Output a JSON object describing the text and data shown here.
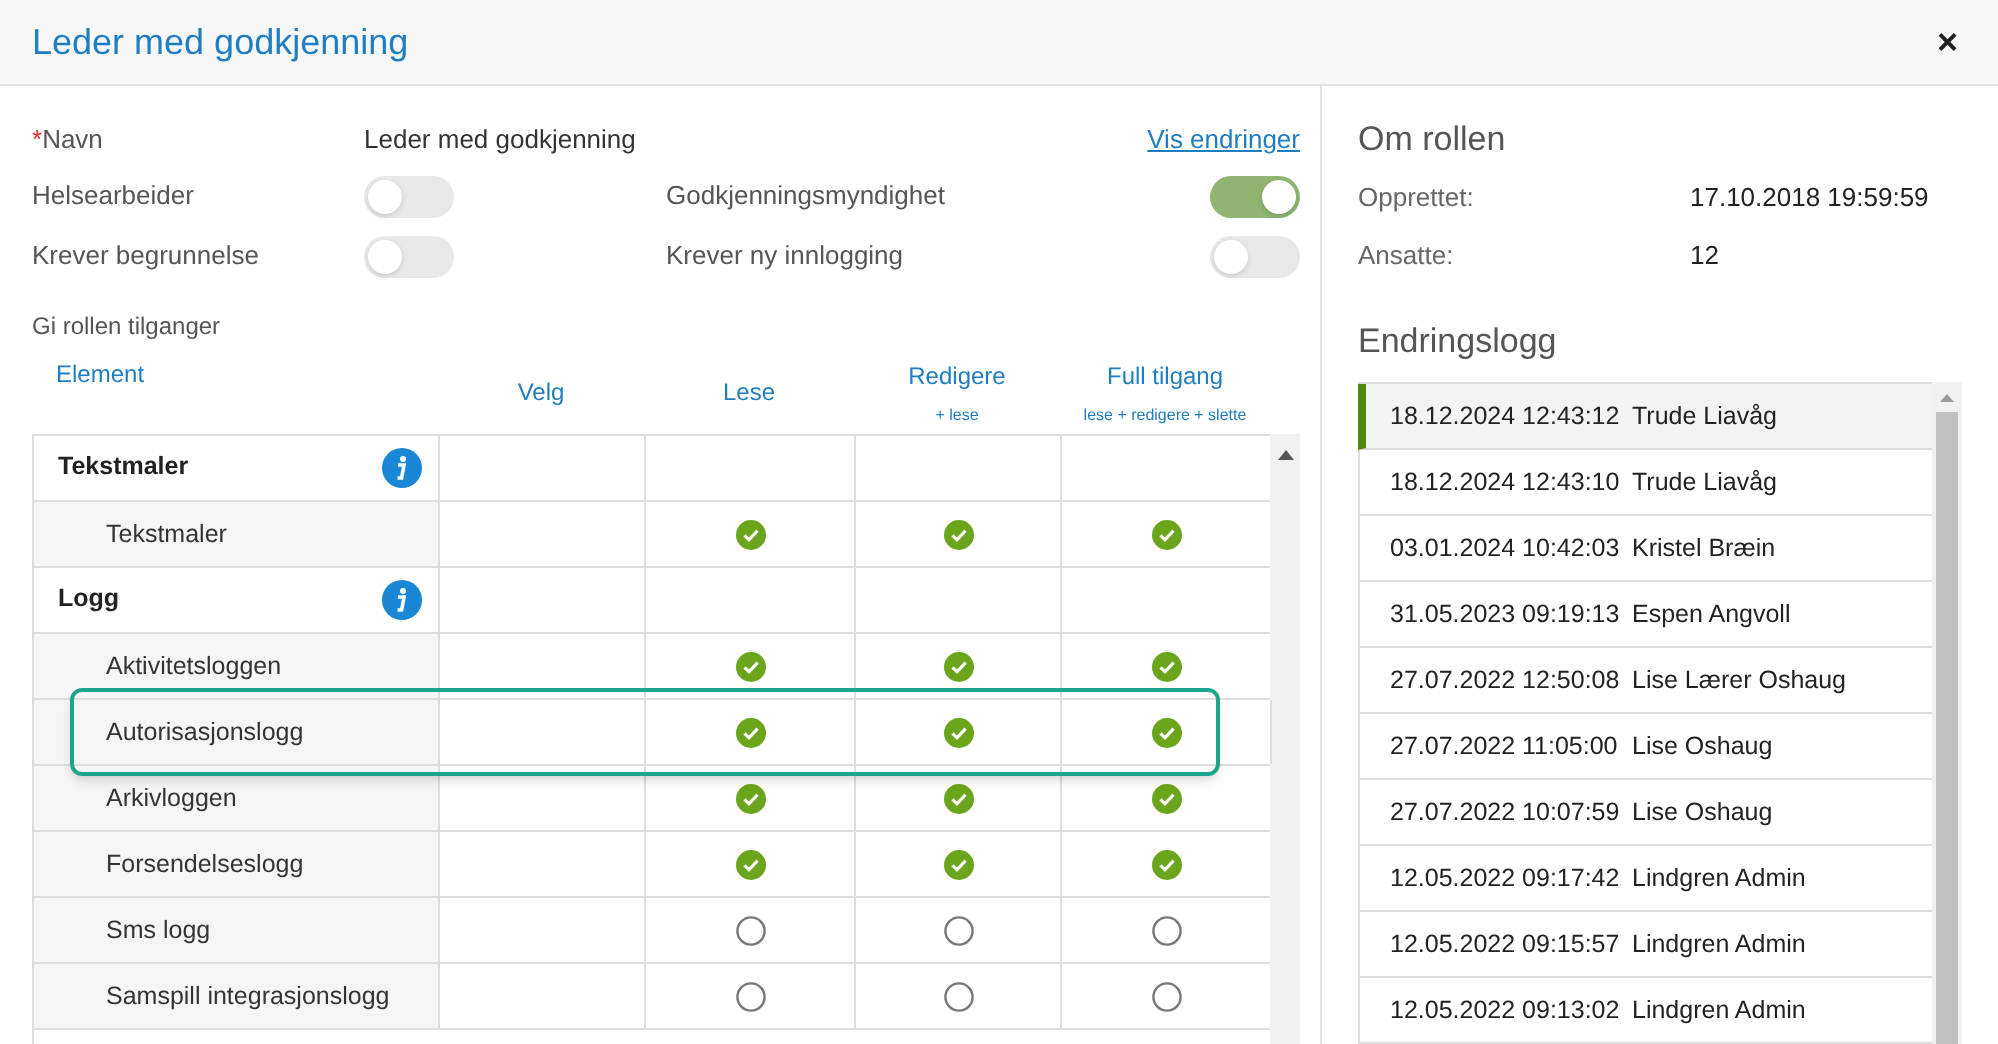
{
  "window": {
    "title": "Leder med godkjenning",
    "close": "×"
  },
  "form": {
    "name_label": "Navn",
    "required_mark": "*",
    "name_value": "Leder med godkjenning",
    "changes_link": "Vis endringer",
    "toggles": [
      {
        "label": "Helsearbeider",
        "on": false
      },
      {
        "label": "Godkjenningsmyndighet",
        "on": true
      },
      {
        "label": "Krever begrunnelse",
        "on": false
      },
      {
        "label": "Krever ny innlogging",
        "on": false
      }
    ],
    "access_label": "Gi rollen tilganger"
  },
  "table": {
    "columns": [
      {
        "label": "Element"
      },
      {
        "label": "Velg"
      },
      {
        "label": "Lese"
      },
      {
        "label": "Redigere",
        "hint": "+ lese"
      },
      {
        "label": "Full tilgang",
        "hint": "lese + redigere + slette"
      }
    ],
    "rows": [
      {
        "kind": "group",
        "label": "Tekstmaler"
      },
      {
        "kind": "item",
        "label": "Tekstmaler",
        "read": true,
        "edit": true,
        "full": true
      },
      {
        "kind": "group",
        "label": "Logg"
      },
      {
        "kind": "item",
        "label": "Aktivitetsloggen",
        "read": true,
        "edit": true,
        "full": true
      },
      {
        "kind": "item",
        "label": "Autorisasjonslogg",
        "read": true,
        "edit": true,
        "full": true,
        "highlighted": true
      },
      {
        "kind": "item",
        "label": "Arkivloggen",
        "read": true,
        "edit": true,
        "full": true
      },
      {
        "kind": "item",
        "label": "Forsendelseslogg",
        "read": true,
        "edit": true,
        "full": true
      },
      {
        "kind": "item",
        "label": "Sms logg",
        "read": false,
        "edit": false,
        "full": false
      },
      {
        "kind": "item",
        "label": "Samspill integrasjonslogg",
        "read": false,
        "edit": false,
        "full": false
      }
    ]
  },
  "about": {
    "title": "Om rollen",
    "fields": [
      {
        "label": "Opprettet:",
        "value": "17.10.2018 19:59:59"
      },
      {
        "label": "Ansatte:",
        "value": "12"
      }
    ]
  },
  "changelog": {
    "title": "Endringslogg",
    "entries": [
      {
        "time": "18.12.2024 12:43:12",
        "user": "Trude Liavåg",
        "selected": true
      },
      {
        "time": "18.12.2024 12:43:10",
        "user": "Trude Liavåg",
        "selected": false
      },
      {
        "time": "03.01.2024 10:42:03",
        "user": "Kristel Bræin",
        "selected": false
      },
      {
        "time": "31.05.2023 09:19:13",
        "user": "Espen Angvoll",
        "selected": false
      },
      {
        "time": "27.07.2022 12:50:08",
        "user": "Lise Lærer Oshaug",
        "selected": false
      },
      {
        "time": "27.07.2022 11:05:00",
        "user": "Lise Oshaug",
        "selected": false
      },
      {
        "time": "27.07.2022 10:07:59",
        "user": "Lise Oshaug",
        "selected": false
      },
      {
        "time": "12.05.2022 09:17:42",
        "user": "Lindgren Admin",
        "selected": false
      },
      {
        "time": "12.05.2022 09:15:57",
        "user": "Lindgren Admin",
        "selected": false
      },
      {
        "time": "12.05.2022 09:13:02",
        "user": "Lindgren Admin",
        "selected": false
      }
    ]
  }
}
